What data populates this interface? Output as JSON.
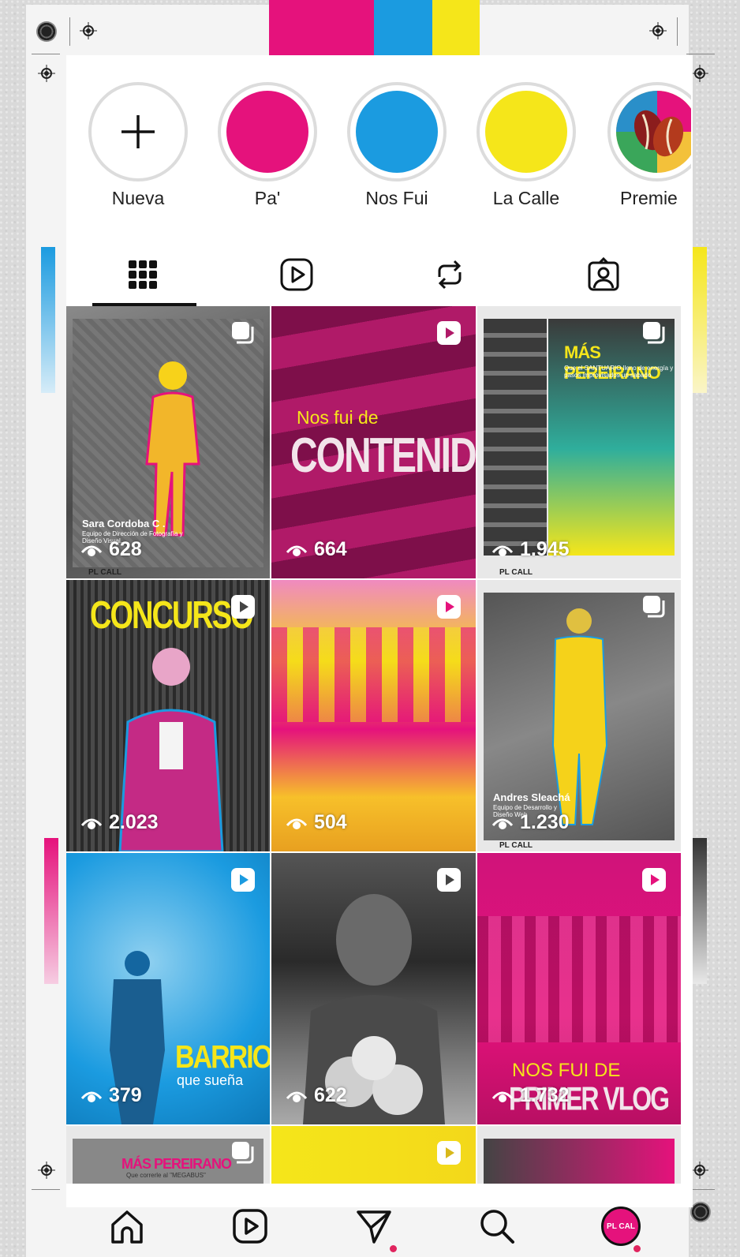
{
  "stories": [
    {
      "label": "Nueva",
      "kind": "add"
    },
    {
      "label": "Pa'",
      "color": "#e5127c"
    },
    {
      "label": "Nos Fui",
      "color": "#1b9be0"
    },
    {
      "label": "La Calle",
      "color": "#f5e61a"
    },
    {
      "label": "Premie",
      "kind": "logo"
    }
  ],
  "tabs": [
    "grid-icon",
    "reels-icon",
    "reposts-icon",
    "tagged-icon"
  ],
  "posts": [
    {
      "views": "628",
      "type": "carousel",
      "caption_name": "Sara Cordoba C .",
      "caption_sub": "Equipo de Dirección de Fotografía y Diseño Visual.",
      "brand": "PL CALL"
    },
    {
      "views": "664",
      "type": "reel",
      "small_title": "Nos fui de",
      "big_title": "CONTENIDO"
    },
    {
      "views": "1.945",
      "type": "carousel",
      "big_title": "MÁS PEREIRANO",
      "sub": "Que el SANTUARIO lleno de energía y pasos improvisados un sabado",
      "brand": "PL CALL"
    },
    {
      "views": "2.023",
      "type": "reel",
      "big_title": "CONCURSO"
    },
    {
      "views": "504",
      "type": "reel"
    },
    {
      "views": "1.230",
      "type": "carousel",
      "caption_name": "Andres Sleachá",
      "caption_sub": "Equipo de Desarrollo y Diseño Web",
      "brand": "PL CALL"
    },
    {
      "views": "379",
      "type": "reel",
      "big_title": "BARRIO",
      "sub": "que sueña"
    },
    {
      "views": "622",
      "type": "reel"
    },
    {
      "views": "1.732",
      "type": "reel",
      "small_title": "NOS FUI DE",
      "big_title": "PRIMER VLOG"
    },
    {
      "views": "",
      "type": "carousel",
      "big_title": "MÁS PEREIRANO",
      "sub": "Que correrle al \"MEGABUS\""
    },
    {
      "views": "",
      "type": "reel"
    },
    {
      "views": "",
      "type": "reel"
    }
  ],
  "nav": [
    "home-icon",
    "reels-icon",
    "messages-icon",
    "search-icon",
    "profile-avatar"
  ],
  "profile_avatar_text": "PL CAL",
  "colors": {
    "magenta": "#e5127c",
    "cyan": "#1b9be0",
    "yellow": "#f5e61a"
  }
}
